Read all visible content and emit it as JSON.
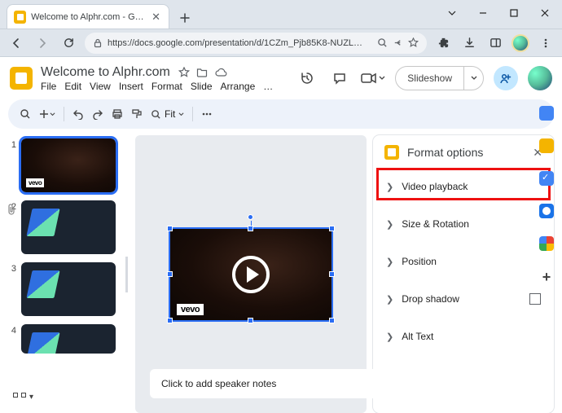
{
  "browser": {
    "tab_title": "Welcome to Alphr.com - Google",
    "url": "https://docs.google.com/presentation/d/1CZm_Pjb85K8-NUZL…"
  },
  "app": {
    "doc_title": "Welcome to Alphr.com",
    "menus": [
      "File",
      "Edit",
      "View",
      "Insert",
      "Format",
      "Slide",
      "Arrange",
      "…"
    ],
    "slideshow_label": "Slideshow",
    "zoom_label": "Fit"
  },
  "thumbs": {
    "items": [
      {
        "num": "1",
        "type": "video"
      },
      {
        "num": "2",
        "type": "deco"
      },
      {
        "num": "3",
        "type": "deco"
      },
      {
        "num": "4",
        "type": "deco"
      }
    ],
    "selected_index": 0
  },
  "video_watermark": "vevo",
  "notes_placeholder": "Click to add speaker notes",
  "panel": {
    "title": "Format options",
    "items": [
      {
        "label": "Video playback",
        "highlight": true
      },
      {
        "label": "Size & Rotation"
      },
      {
        "label": "Position"
      },
      {
        "label": "Drop shadow",
        "checkbox": true
      },
      {
        "label": "Alt Text"
      }
    ]
  }
}
